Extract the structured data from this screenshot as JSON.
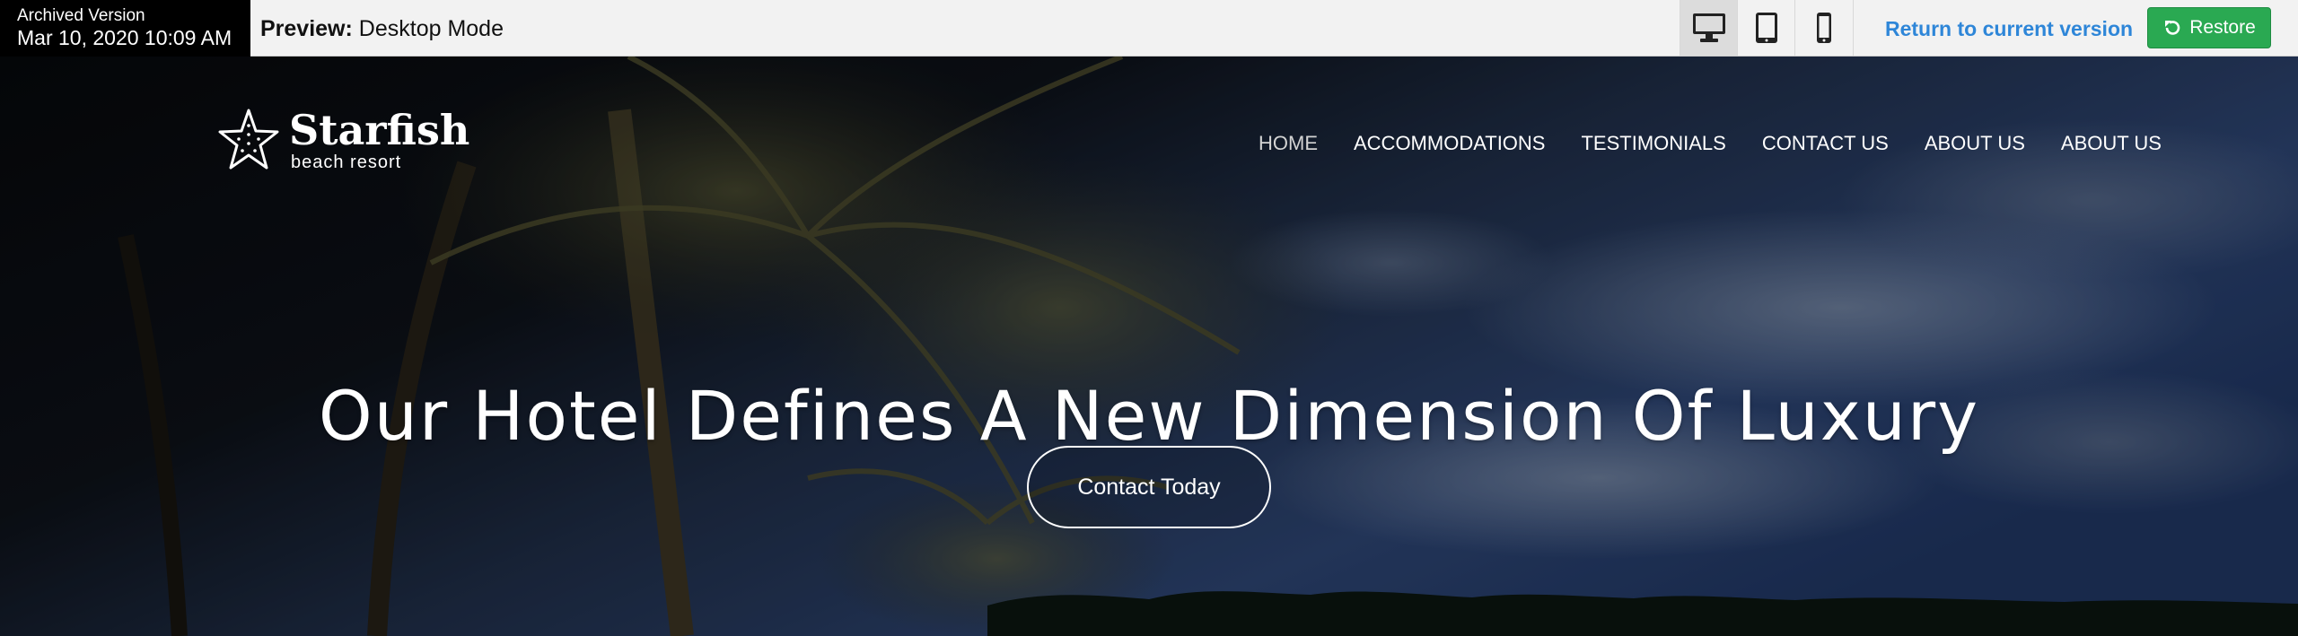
{
  "archive": {
    "label": "Archived Version",
    "date": "Mar 10, 2020 10:09 AM"
  },
  "preview": {
    "prefix": "Preview:",
    "mode": "Desktop Mode"
  },
  "devices": [
    {
      "name": "desktop",
      "icon": "desktop-icon",
      "active": true
    },
    {
      "name": "tablet",
      "icon": "tablet-icon",
      "active": false
    },
    {
      "name": "mobile",
      "icon": "mobile-icon",
      "active": false
    }
  ],
  "toolbar": {
    "return_label": "Return to current version",
    "restore_label": "Restore",
    "return_color": "#2e86d8",
    "restore_color": "#2aa952"
  },
  "site": {
    "logo": {
      "name": "Starfish",
      "tagline": "beach resort",
      "icon": "starfish-icon"
    },
    "nav": [
      {
        "label": "HOME",
        "current": true
      },
      {
        "label": "ACCOMMODATIONS",
        "current": false
      },
      {
        "label": "TESTIMONIALS",
        "current": false
      },
      {
        "label": "CONTACT US",
        "current": false
      },
      {
        "label": "ABOUT US",
        "current": false
      },
      {
        "label": "ABOUT US",
        "current": false
      }
    ],
    "headline": "Our Hotel Defines A New Dimension Of Luxury",
    "cta_label": "Contact Today"
  }
}
